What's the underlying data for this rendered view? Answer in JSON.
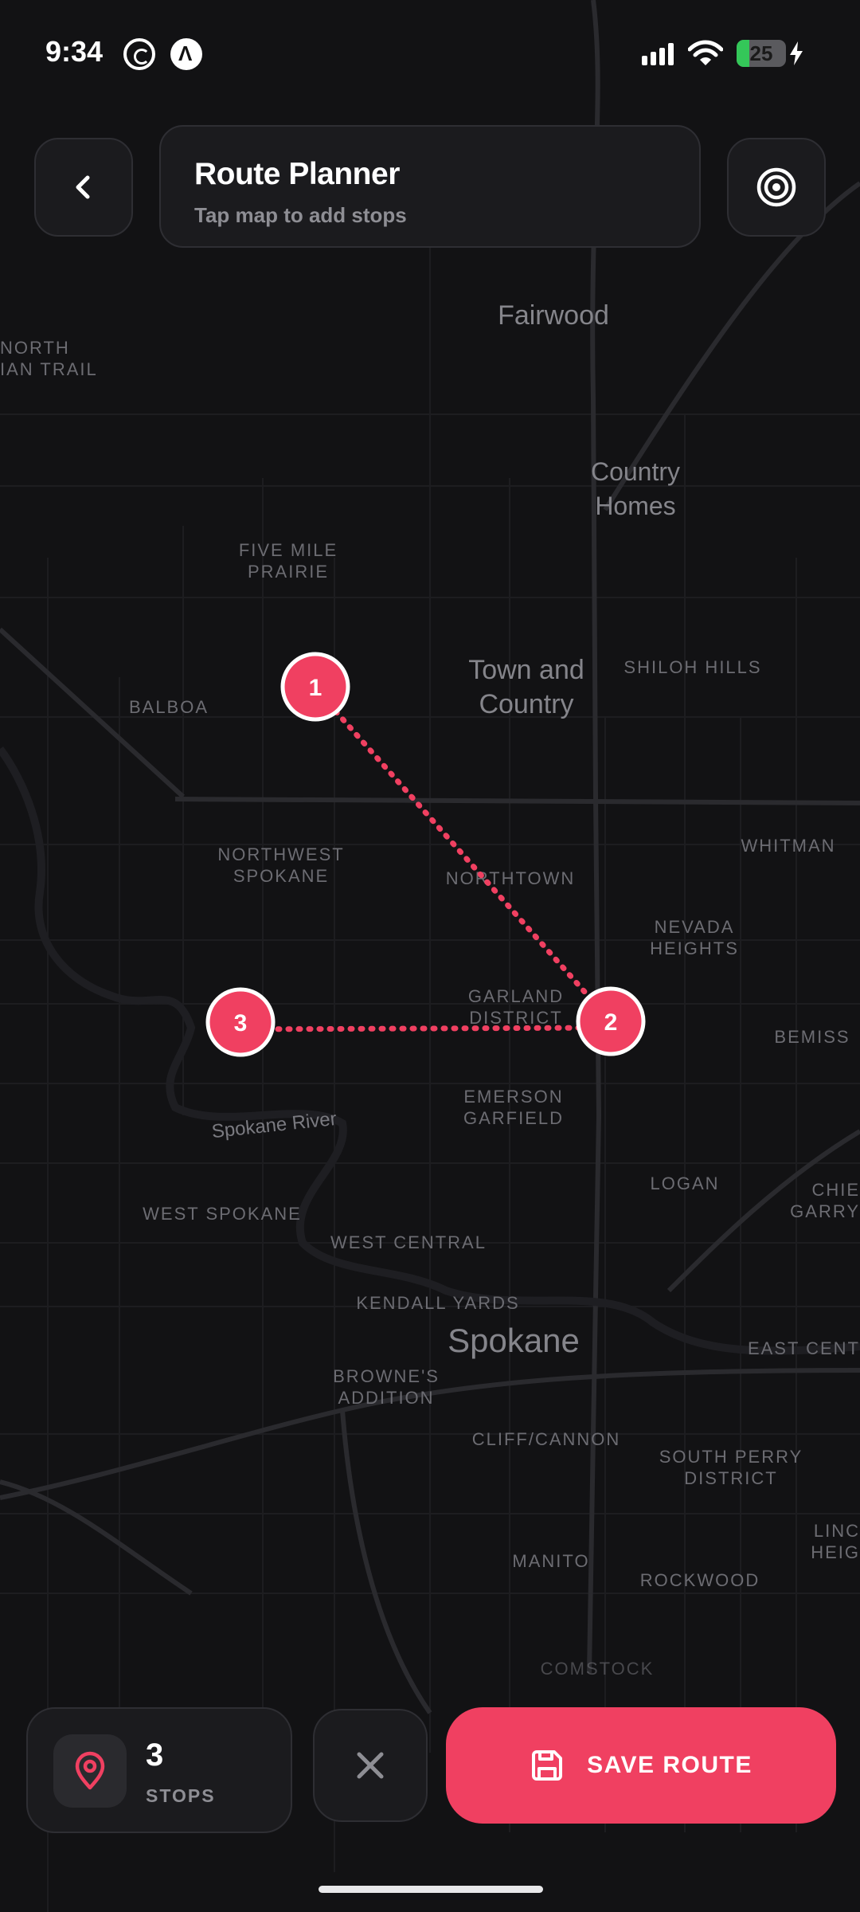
{
  "status_bar": {
    "time": "9:34",
    "battery_level": "25",
    "battery_percent": 0.25,
    "icons": [
      "whatsapp-icon",
      "arc-icon",
      "signal-icon",
      "wifi-icon",
      "battery-icon",
      "charging-bolt-icon"
    ]
  },
  "header": {
    "title": "Route Planner",
    "subtitle": "Tap map to add stops",
    "back_icon": "chevron-left-icon",
    "locate_icon": "target-icon"
  },
  "map": {
    "labels": {
      "fairwood": "Fairwood",
      "country_homes_1": "Country",
      "country_homes_2": "Homes",
      "north_trail_1": "NORTH",
      "north_trail_2": "IAN TRAIL",
      "five_mile_1": "FIVE MILE",
      "five_mile_2": "PRAIRIE",
      "town_country_1": "Town and",
      "town_country_2": "Country",
      "shiloh_hills": "SHILOH HILLS",
      "balboa": "BALBOA",
      "nw_spokane_1": "NORTHWEST",
      "nw_spokane_2": "SPOKANE",
      "northtown": "NORTHTOWN",
      "whitman": "WHITMAN",
      "nevada_heights_1": "NEVADA",
      "nevada_heights_2": "HEIGHTS",
      "garland_1": "GARLAND",
      "garland_2": "DISTRICT",
      "bemiss": "BEMISS",
      "emerson_1": "EMERSON",
      "emerson_2": "GARFIELD",
      "spokane_river": "Spokane River",
      "logan": "LOGAN",
      "chief_garry_1": "CHIE",
      "chief_garry_2": "GARRY",
      "west_spokane": "WEST SPOKANE",
      "west_central": "WEST CENTRAL",
      "kendall_yards": "KENDALL YARDS",
      "spokane": "Spokane",
      "east_central": "EAST CENT",
      "brownes_1": "BROWNE'S",
      "brownes_2": "ADDITION",
      "cliff_cannon": "CLIFF/CANNON",
      "south_perry_1": "SOUTH PERRY",
      "south_perry_2": "DISTRICT",
      "lincoln_1": "LINC",
      "lincoln_2": "HEIG",
      "manito": "MANITO",
      "rockwood": "ROCKWOOD",
      "comstock": "COMSTOCK"
    },
    "route_color": "#f04061",
    "stops": [
      {
        "label": "1"
      },
      {
        "label": "2"
      },
      {
        "label": "3"
      }
    ]
  },
  "bottom_bar": {
    "stops_count": "3",
    "stops_label": "STOPS",
    "stops_icon": "map-pin-icon",
    "clear_icon": "close-icon",
    "save_label": "SAVE ROUTE",
    "save_icon": "floppy-disk-icon",
    "accent": "#f04061"
  }
}
